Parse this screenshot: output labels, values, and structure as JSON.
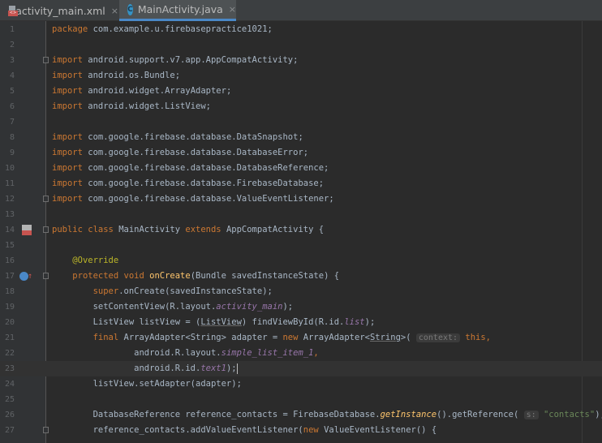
{
  "tabs": [
    {
      "label": "activity_main.xml",
      "icon": "xml-file-icon",
      "close": "×",
      "active": false
    },
    {
      "label": "MainActivity.java",
      "icon": "java-class-icon",
      "close": "×",
      "active": true
    }
  ],
  "editor": {
    "current_line": 23,
    "lines": [
      {
        "n": "1",
        "t": [
          [
            "kw",
            "package "
          ],
          [
            "",
            "com.example.u.firebasepractice1021;"
          ]
        ]
      },
      {
        "n": "2",
        "t": []
      },
      {
        "n": "3",
        "t": [
          [
            "kw",
            "import "
          ],
          [
            "",
            "android.support.v7.app.AppCompatActivity;"
          ]
        ]
      },
      {
        "n": "4",
        "t": [
          [
            "kw",
            "import "
          ],
          [
            "",
            "android.os.Bundle;"
          ]
        ]
      },
      {
        "n": "5",
        "t": [
          [
            "kw",
            "import "
          ],
          [
            "",
            "android.widget.ArrayAdapter;"
          ]
        ]
      },
      {
        "n": "6",
        "t": [
          [
            "kw",
            "import "
          ],
          [
            "",
            "android.widget.ListView;"
          ]
        ]
      },
      {
        "n": "7",
        "t": []
      },
      {
        "n": "8",
        "t": [
          [
            "kw",
            "import "
          ],
          [
            "",
            "com.google.firebase.database.DataSnapshot;"
          ]
        ]
      },
      {
        "n": "9",
        "t": [
          [
            "kw",
            "import "
          ],
          [
            "",
            "com.google.firebase.database.DatabaseError;"
          ]
        ]
      },
      {
        "n": "10",
        "t": [
          [
            "kw",
            "import "
          ],
          [
            "",
            "com.google.firebase.database.DatabaseReference;"
          ]
        ]
      },
      {
        "n": "11",
        "t": [
          [
            "kw",
            "import "
          ],
          [
            "",
            "com.google.firebase.database.FirebaseDatabase;"
          ]
        ]
      },
      {
        "n": "12",
        "t": [
          [
            "kw",
            "import "
          ],
          [
            "",
            "com.google.firebase.database.ValueEventListener;"
          ]
        ]
      },
      {
        "n": "13",
        "t": []
      },
      {
        "n": "14",
        "t": [
          [
            "kw",
            "public class "
          ],
          [
            "",
            "MainActivity "
          ],
          [
            "kw",
            "extends "
          ],
          [
            "",
            "AppCompatActivity {"
          ]
        ]
      },
      {
        "n": "15",
        "t": []
      },
      {
        "n": "16",
        "t": [
          [
            "",
            "    "
          ],
          [
            "an",
            "@Override"
          ]
        ]
      },
      {
        "n": "17",
        "t": [
          [
            "",
            "    "
          ],
          [
            "kw",
            "protected void "
          ],
          [
            "fn",
            "onCreate"
          ],
          [
            "",
            "(Bundle savedInstanceState) {"
          ]
        ]
      },
      {
        "n": "18",
        "t": [
          [
            "",
            "        "
          ],
          [
            "kw",
            "super"
          ],
          [
            "",
            ".onCreate(savedInstanceState);"
          ]
        ]
      },
      {
        "n": "19",
        "t": [
          [
            "",
            "        setContentView(R.layout."
          ],
          [
            "pu",
            "activity_main"
          ],
          [
            "",
            ");"
          ]
        ]
      },
      {
        "n": "20",
        "t": [
          [
            "",
            "        ListView listView = ("
          ],
          [
            "un",
            "ListView"
          ],
          [
            "",
            ") findViewById(R.id."
          ],
          [
            "pu",
            "list"
          ],
          [
            "",
            ");"
          ]
        ]
      },
      {
        "n": "21",
        "t": [
          [
            "",
            "        "
          ],
          [
            "kw",
            "final "
          ],
          [
            "",
            "ArrayAdapter<String> adapter = "
          ],
          [
            "kw",
            "new "
          ],
          [
            "",
            "ArrayAdapter<"
          ],
          [
            "un",
            "String"
          ],
          [
            "",
            ">( "
          ],
          [
            "hint",
            "context:"
          ],
          [
            "",
            ""
          ],
          [
            "kw",
            " this"
          ],
          [
            "kw",
            ","
          ]
        ]
      },
      {
        "n": "22",
        "t": [
          [
            "",
            "                android.R.layout."
          ],
          [
            "pu",
            "simple_list_item_1"
          ],
          [
            "kw",
            ","
          ]
        ]
      },
      {
        "n": "23",
        "t": [
          [
            "",
            "                android.R.id."
          ],
          [
            "pu",
            "text1"
          ],
          [
            "",
            ");"
          ],
          [
            "caret",
            ""
          ]
        ]
      },
      {
        "n": "24",
        "t": [
          [
            "",
            "        listView.setAdapter(adapter);"
          ]
        ]
      },
      {
        "n": "25",
        "t": []
      },
      {
        "n": "26",
        "t": [
          [
            "",
            "        DatabaseReference reference_contacts = FirebaseDatabase."
          ],
          [
            "fn-i",
            "getInstance"
          ],
          [
            "",
            "().getReference( "
          ],
          [
            "hint",
            "s:"
          ],
          [
            "st",
            " \"contacts\""
          ],
          [
            "",
            ");"
          ]
        ]
      },
      {
        "n": "27",
        "t": [
          [
            "",
            "        reference_contacts.addValueEventListener("
          ],
          [
            "kw",
            "new "
          ],
          [
            "",
            "ValueEventListener() {"
          ]
        ]
      }
    ]
  }
}
